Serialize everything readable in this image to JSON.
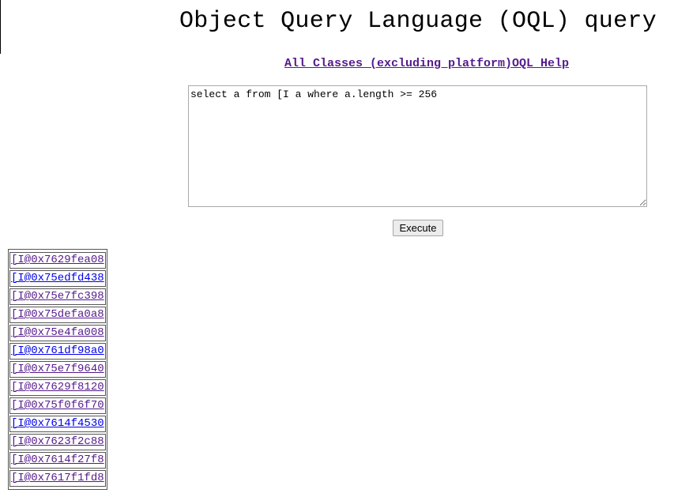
{
  "page": {
    "title": "Object Query Language (OQL) query"
  },
  "nav": {
    "all_classes": "All Classes (excluding platform)",
    "oql_help": "OQL Help"
  },
  "query": {
    "text": "select a from [I a where a.length >= 256"
  },
  "execute_label": "Execute",
  "results": [
    "[I@0x7629fea08",
    "[I@0x75edfd438",
    "[I@0x75e7fc398",
    "[I@0x75defa0a8",
    "[I@0x75e4fa008",
    "[I@0x761df98a0",
    "[I@0x75e7f9640",
    "[I@0x7629f8120",
    "[I@0x75f0f6f70",
    "[I@0x7614f4530",
    "[I@0x7623f2c88",
    "[I@0x7614f27f8",
    "[I@0x7617f1fd8"
  ],
  "colors": {
    "link_visited": "#551a8b",
    "link_unvisited": "#0000ee"
  }
}
